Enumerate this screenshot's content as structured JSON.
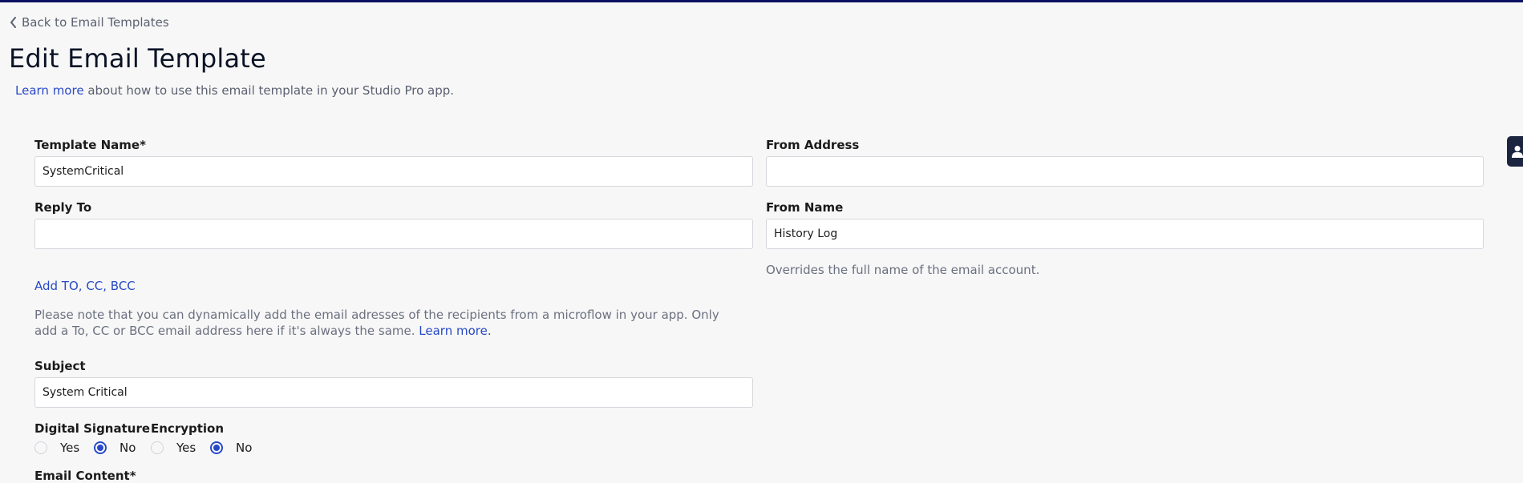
{
  "nav": {
    "back_label": "Back to Email Templates"
  },
  "page": {
    "title": "Edit Email Template",
    "intro_link": "Learn more",
    "intro_text": " about how to use this email template in your Studio Pro app."
  },
  "form": {
    "template_name": {
      "label": "Template Name*",
      "value": "SystemCritical"
    },
    "from_address": {
      "label": "From Address",
      "value": ""
    },
    "reply_to": {
      "label": "Reply To",
      "value": ""
    },
    "from_name": {
      "label": "From Name",
      "value": "History Log",
      "help": "Overrides the full name of the email account."
    },
    "add_recipients_link": "Add TO, CC, BCC",
    "recipients_note": "Please note that you can dynamically add the email adresses of the recipients from a microflow in your app. Only add a To, CC or BCC email address here if it's always the same. ",
    "recipients_note_link": "Learn more.",
    "subject": {
      "label": "Subject",
      "value": "System Critical"
    },
    "digital_signature": {
      "label": "Digital Signature",
      "options": [
        "Yes",
        "No"
      ],
      "selected": "No"
    },
    "encryption": {
      "label": "Encryption",
      "options": [
        "Yes",
        "No"
      ],
      "selected": "No"
    },
    "email_content_label": "Email Content*"
  },
  "colors": {
    "accent": "#2849c7",
    "top_bar": "#0b1061",
    "side_tab": "#1c2540"
  },
  "icons": {
    "back": "chevron-left-icon",
    "side_tab": "user-icon"
  }
}
